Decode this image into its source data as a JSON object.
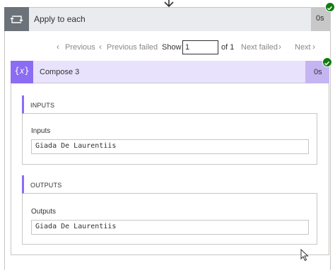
{
  "apply_to_each": {
    "title": "Apply to each",
    "duration": "0s",
    "status_color": "#107c10"
  },
  "pager": {
    "previous_label": "Previous",
    "previous_failed_label": "Previous failed",
    "show_label": "Show",
    "page_value": "1",
    "of_label": "of 1",
    "next_failed_label": "Next failed",
    "next_label": "Next"
  },
  "compose": {
    "title": "Compose 3",
    "icon_glyph": "{𝑥}",
    "duration": "0s",
    "accent_color": "#8c6cf2",
    "header_color": "#e9e2fd"
  },
  "inputs": {
    "section_title": "INPUTS",
    "field_label": "Inputs",
    "value": "Giada De Laurentiis"
  },
  "outputs": {
    "section_title": "OUTPUTS",
    "field_label": "Outputs",
    "value": "Giada De Laurentiis"
  },
  "icons": {
    "top_arrow": "arrow-down-icon",
    "apply_icon": "loop-icon",
    "status": "checkmark-icon",
    "cursor": "mouse-cursor-icon"
  }
}
